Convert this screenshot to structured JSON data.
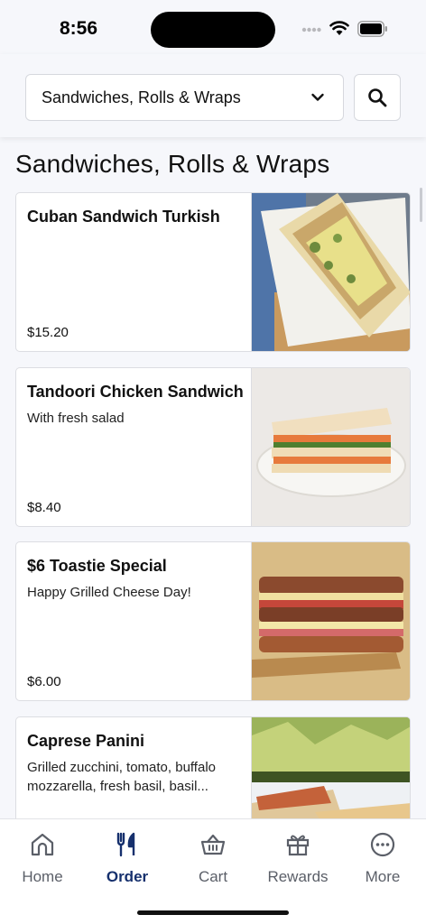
{
  "status_bar": {
    "time": "8:56"
  },
  "header": {
    "category_selected": "Sandwiches, Rolls & Wraps"
  },
  "page_title": "Sandwiches, Rolls & Wraps",
  "items": [
    {
      "name": "Cuban Sandwich Turkish",
      "description": "",
      "price": "$15.20"
    },
    {
      "name": "Tandoori Chicken Sandwich",
      "description": "With fresh salad",
      "price": "$8.40"
    },
    {
      "name": "$6 Toastie Special",
      "description": "Happy Grilled Cheese Day!",
      "price": "$6.00"
    },
    {
      "name": "Caprese Panini",
      "description": "Grilled zucchini, tomato, buffalo mozzarella, fresh basil, basil...",
      "price": ""
    }
  ],
  "tabs": [
    {
      "label": "Home",
      "icon": "home-icon"
    },
    {
      "label": "Order",
      "icon": "fork-knife-icon",
      "active": true
    },
    {
      "label": "Cart",
      "icon": "basket-icon"
    },
    {
      "label": "Rewards",
      "icon": "gift-icon"
    },
    {
      "label": "More",
      "icon": "more-dots-icon"
    }
  ],
  "colors": {
    "accent": "#16306d",
    "background": "#f6f7fb"
  }
}
